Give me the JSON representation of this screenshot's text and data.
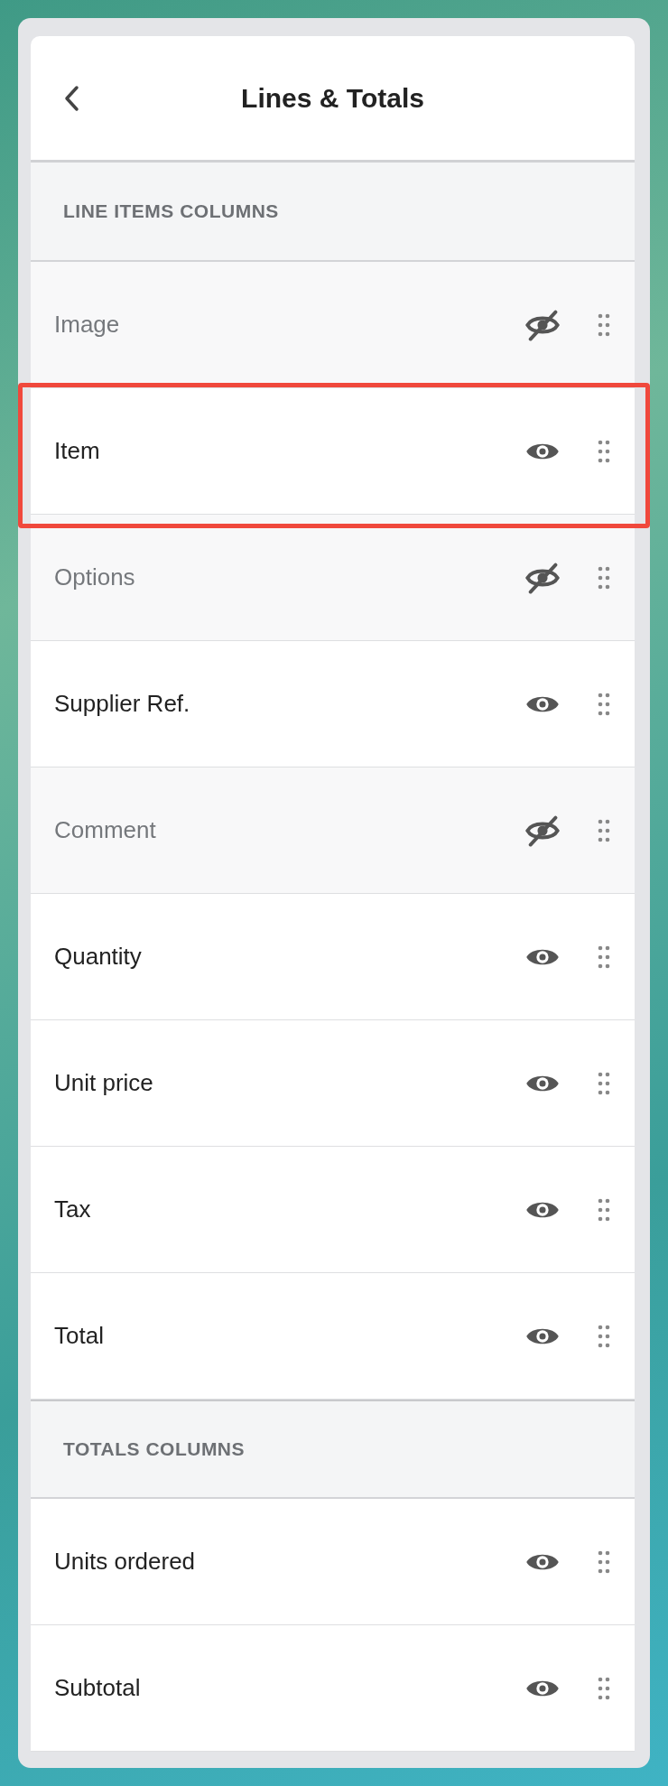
{
  "header": {
    "title": "Lines & Totals"
  },
  "sections": [
    {
      "heading": "LINE ITEMS COLUMNS",
      "rows": [
        {
          "label": "Image",
          "visible": false,
          "highlighted": false
        },
        {
          "label": "Item",
          "visible": true,
          "highlighted": true
        },
        {
          "label": "Options",
          "visible": false,
          "highlighted": false
        },
        {
          "label": "Supplier Ref.",
          "visible": true,
          "highlighted": false
        },
        {
          "label": "Comment",
          "visible": false,
          "highlighted": false
        },
        {
          "label": "Quantity",
          "visible": true,
          "highlighted": false
        },
        {
          "label": "Unit price",
          "visible": true,
          "highlighted": false
        },
        {
          "label": "Tax",
          "visible": true,
          "highlighted": false
        },
        {
          "label": "Total",
          "visible": true,
          "highlighted": false
        }
      ]
    },
    {
      "heading": "TOTALS COLUMNS",
      "rows": [
        {
          "label": "Units ordered",
          "visible": true,
          "highlighted": false
        },
        {
          "label": "Subtotal",
          "visible": true,
          "highlighted": false
        }
      ]
    }
  ]
}
